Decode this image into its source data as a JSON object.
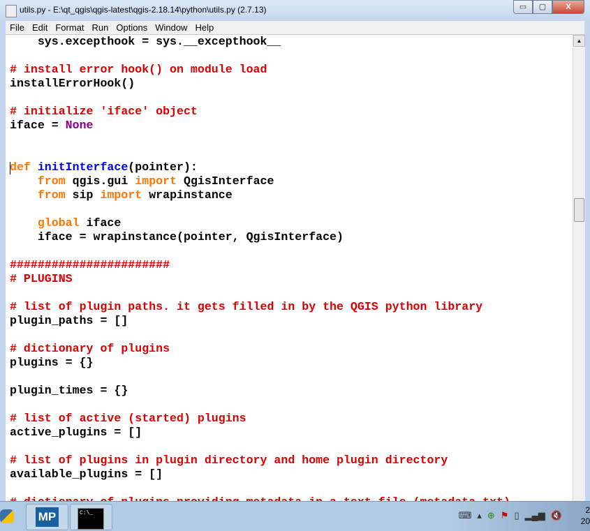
{
  "window": {
    "title": "utils.py - E:\\qt_qgis\\qgis-latest\\qgis-2.18.14\\python\\utils.py (2.7.13)",
    "minimize": "▭",
    "maximize": "▢",
    "close": "X"
  },
  "menu": [
    "File",
    "Edit",
    "Format",
    "Run",
    "Options",
    "Window",
    "Help"
  ],
  "colors": {
    "keyword": "#ff7700",
    "comment": "#dd0000",
    "defname": "#0000ff",
    "builtin": "#900090",
    "text": "#000000"
  },
  "code": [
    [
      [
        "t",
        "    sys.excepthook = sys.__excepthook__"
      ]
    ],
    [],
    [
      [
        "c",
        "# install error hook() on module load"
      ]
    ],
    [
      [
        "t",
        "installErrorHook()"
      ]
    ],
    [],
    [
      [
        "c",
        "# initialize 'iface' object"
      ]
    ],
    [
      [
        "t",
        "iface = "
      ],
      [
        "b",
        "None"
      ]
    ],
    [],
    [],
    [
      [
        "k",
        "def"
      ],
      [
        "t",
        " "
      ],
      [
        "d",
        "initInterface"
      ],
      [
        "t",
        "(pointer):"
      ]
    ],
    [
      [
        "t",
        "    "
      ],
      [
        "k",
        "from"
      ],
      [
        "t",
        " qgis.gui "
      ],
      [
        "k",
        "import"
      ],
      [
        "t",
        " QgisInterface"
      ]
    ],
    [
      [
        "t",
        "    "
      ],
      [
        "k",
        "from"
      ],
      [
        "t",
        " sip "
      ],
      [
        "k",
        "import"
      ],
      [
        "t",
        " wrapinstance"
      ]
    ],
    [],
    [
      [
        "t",
        "    "
      ],
      [
        "k",
        "global"
      ],
      [
        "t",
        " iface"
      ]
    ],
    [
      [
        "t",
        "    iface = wrapinstance(pointer, QgisInterface)"
      ]
    ],
    [],
    [
      [
        "c",
        "#######################"
      ]
    ],
    [
      [
        "c",
        "# PLUGINS"
      ]
    ],
    [],
    [
      [
        "c",
        "# list of plugin paths. it gets filled in by the QGIS python library"
      ]
    ],
    [
      [
        "t",
        "plugin_paths = []"
      ]
    ],
    [],
    [
      [
        "c",
        "# dictionary of plugins"
      ]
    ],
    [
      [
        "t",
        "plugins = {}"
      ]
    ],
    [],
    [
      [
        "t",
        "plugin_times = {}"
      ]
    ],
    [],
    [
      [
        "c",
        "# list of active (started) plugins"
      ]
    ],
    [
      [
        "t",
        "active_plugins = []"
      ]
    ],
    [],
    [
      [
        "c",
        "# list of plugins in plugin directory and home plugin directory"
      ]
    ],
    [
      [
        "t",
        "available_plugins = []"
      ]
    ],
    [],
    [
      [
        "c",
        "# dictionary of plugins providing metadata in a text file (metadata.txt)"
      ]
    ]
  ],
  "taskbar": {
    "items": [
      {
        "icon": "python-icon"
      },
      {
        "icon": "mp-icon",
        "label": "MP"
      },
      {
        "icon": "cmd-icon",
        "label": "C:\\_"
      }
    ],
    "tray": [
      "keyboard-icon",
      "show-hidden-icon",
      "plus-icon",
      "flag-icon",
      "power-icon",
      "signal-icon",
      "volume-muted-icon"
    ],
    "clock": [
      "2",
      "20"
    ]
  }
}
